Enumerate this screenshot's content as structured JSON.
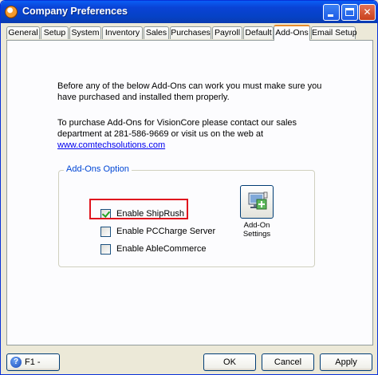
{
  "window": {
    "title": "Company Preferences",
    "icon": "app-orb-icon"
  },
  "tabs": [
    {
      "label": "General"
    },
    {
      "label": "Setup"
    },
    {
      "label": "System"
    },
    {
      "label": "Inventory"
    },
    {
      "label": "Sales"
    },
    {
      "label": "Purchases"
    },
    {
      "label": "Payroll"
    },
    {
      "label": "Default"
    },
    {
      "label": "Add-Ons",
      "active": true
    },
    {
      "label": "Email Setup"
    }
  ],
  "addons": {
    "intro": "Before any of the below Add-Ons can work you must make sure you have purchased and installed them properly.",
    "purchase_text": "To purchase Add-Ons for VisionCore please contact our sales department at 281-586-9669 or visit us on the web at ",
    "link": "www.comtechsolutions.com",
    "group_title": "Add-Ons Option",
    "options": [
      {
        "label": "Enable ShipRush",
        "checked": true
      },
      {
        "label": "Enable PCCharge Server",
        "checked": false
      },
      {
        "label": "Enable AbleCommerce",
        "checked": false
      }
    ],
    "settings_button_label": "Add-On Settings"
  },
  "buttons": {
    "help": "F1 - Help",
    "ok": "OK",
    "cancel": "Cancel",
    "apply": "Apply"
  },
  "colors": {
    "titlebar": "#0a43d6",
    "highlight": "#e0141e",
    "link": "#0000ee",
    "active_tab_accent": "#e68b2c"
  }
}
